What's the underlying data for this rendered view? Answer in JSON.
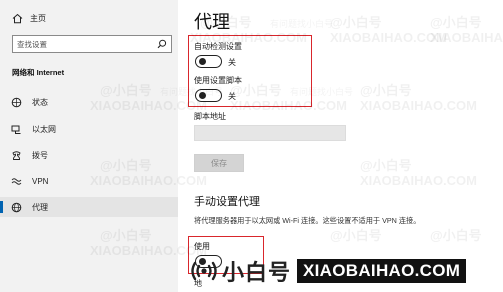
{
  "sidebar": {
    "home_label": "主页",
    "search_placeholder": "查找设置",
    "section_title": "网络和 Internet",
    "items": [
      {
        "label": "状态",
        "icon": "globe-status-icon",
        "active": false
      },
      {
        "label": "以太网",
        "icon": "ethernet-icon",
        "active": false
      },
      {
        "label": "拨号",
        "icon": "dial-up-icon",
        "active": false
      },
      {
        "label": "VPN",
        "icon": "vpn-icon",
        "active": false
      },
      {
        "label": "代理",
        "icon": "globe-proxy-icon",
        "active": true
      }
    ]
  },
  "main": {
    "title": "代理",
    "auto_detect": {
      "label": "自动检测设置",
      "state": "关"
    },
    "use_script": {
      "label": "使用设置脚本",
      "state": "关"
    },
    "script_address_label": "脚本地址",
    "script_address_value": "",
    "save_button": "保存",
    "manual_section_title": "手动设置代理",
    "manual_description": "将代理服务器用于以太网或 Wi-Fi 连接。这些设置不适用于 VPN 连接。",
    "partial_label_1": "使用",
    "partial_label_2": "地"
  },
  "watermark": {
    "text_cn": "@小白号",
    "text_en": "XIAOBAIHAO.COM",
    "small_text": "有问题找小白号"
  },
  "logo": {
    "brand_cn": "小白号",
    "brand_en": "XIAOBAIHAO.COM"
  },
  "colors": {
    "accent": "#0063b1",
    "highlight_box": "#d9262c",
    "sidebar_bg": "#f2f2f2"
  }
}
